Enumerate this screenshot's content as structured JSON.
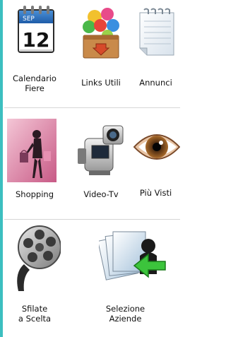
{
  "colors": {
    "accent": "#3cbfc0",
    "divider": "#d6d6d6",
    "text": "#111111"
  },
  "tiles": [
    {
      "label": "Calendario\nFiere",
      "icon": "calendar-icon",
      "calendar_month": "SEP",
      "calendar_day": "12"
    },
    {
      "label": "Links Utili",
      "icon": "links-box-icon"
    },
    {
      "label": "Annunci",
      "icon": "notepad-icon"
    },
    {
      "label": "Shopping",
      "icon": "shopping-woman-icon"
    },
    {
      "label": "Video-Tv",
      "icon": "video-camera-icon"
    },
    {
      "label": "Più Visti",
      "icon": "eye-icon"
    },
    {
      "label": "Sfilate\na Scelta",
      "icon": "film-reel-icon"
    },
    {
      "label": "Selezione\nAziende",
      "icon": "selection-arrow-icon"
    }
  ]
}
